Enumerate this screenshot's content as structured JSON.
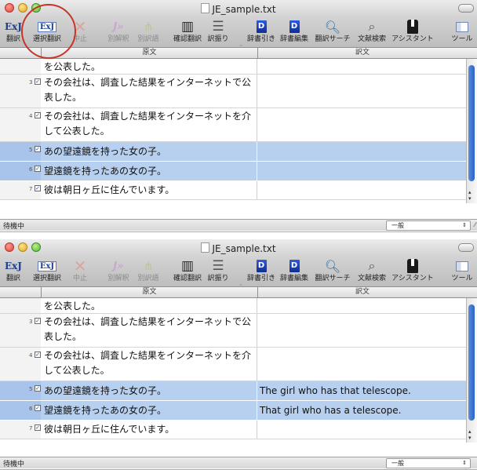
{
  "window_title": "JE_sample.txt",
  "toolbar": {
    "translate": "翻訳",
    "selection_translate": "選択翻訳",
    "stop": "中止",
    "alt_interpretation": "別解釈",
    "alt_word": "別訳語",
    "confirm_translate": "確認翻訳",
    "reading_assign": "訳振り",
    "dictionary_lookup": "辞書引き",
    "dictionary_edit": "辞書編集",
    "translation_search": "翻訳サーチ",
    "literature_search": "文献検索",
    "assistant": "アシスタント",
    "tools": "ツール",
    "ej_icon": "ExJ"
  },
  "columns": {
    "source": "原文",
    "translation": "訳文"
  },
  "rows": [
    {
      "num": "",
      "checked": false,
      "source": "を公表した。",
      "translation_top": "",
      "translation_bottom": "",
      "selected": false
    },
    {
      "num": "3",
      "checked": true,
      "source": "その会社は、調査した結果をインターネットで公表した。",
      "translation_top": "",
      "translation_bottom": "",
      "selected": false
    },
    {
      "num": "4",
      "checked": true,
      "source": "その会社は、調査した結果をインターネットを介して公表した。",
      "translation_top": "",
      "translation_bottom": "",
      "selected": false
    },
    {
      "num": "5",
      "checked": true,
      "source": "あの望遠鏡を持った女の子。",
      "translation_top": "",
      "translation_bottom": "The girl who has that telescope.",
      "selected": true
    },
    {
      "num": "6",
      "checked": true,
      "source": "望遠鏡を持ったあの女の子。",
      "translation_top": "",
      "translation_bottom": "That girl who has a telescope.",
      "selected": true
    },
    {
      "num": "7",
      "checked": true,
      "source": "彼は朝日ヶ丘に住んでいます。",
      "translation_top": "",
      "translation_bottom": "",
      "selected": false
    }
  ],
  "status": {
    "text": "待機中",
    "mode": "一般"
  },
  "annotation": {
    "color": "#c7342a"
  },
  "colors": {
    "selection": "#b8d0ef",
    "scroll_thumb": "#2a62c6"
  }
}
